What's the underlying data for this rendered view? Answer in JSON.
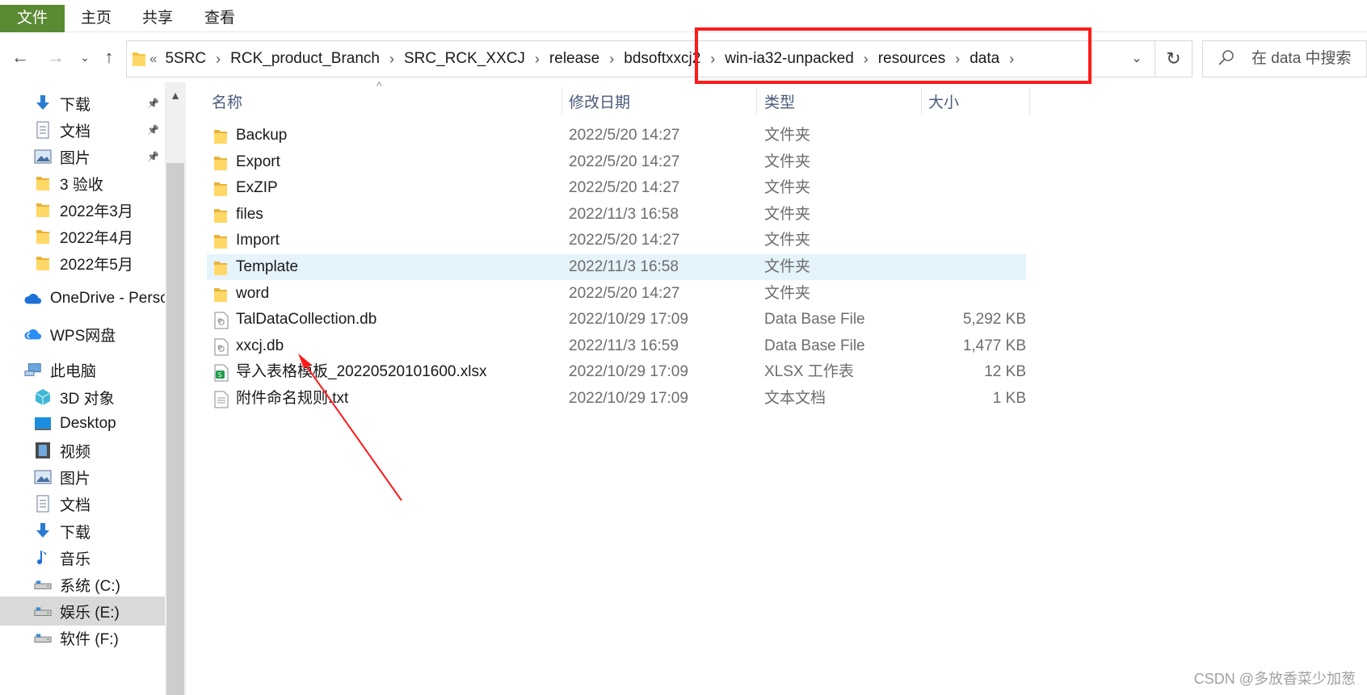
{
  "ribbon": {
    "file": "文件",
    "home": "主页",
    "share": "共享",
    "view": "查看"
  },
  "address": {
    "lead": "«",
    "crumbs": [
      "5SRC",
      "RCK_product_Branch",
      "SRC_RCK_XXCJ",
      "release",
      "bdsoftxxcj2",
      "win-ia32-unpacked",
      "resources",
      "data"
    ]
  },
  "search": {
    "placeholder": "在 data 中搜索"
  },
  "sidebar": {
    "items": [
      {
        "label": "下载",
        "icon": "download-arrow-icon",
        "pinned": true
      },
      {
        "label": "文档",
        "icon": "document-icon",
        "pinned": true
      },
      {
        "label": "图片",
        "icon": "picture-icon",
        "pinned": true
      },
      {
        "label": "3 验收",
        "icon": "folder-icon"
      },
      {
        "label": "2022年3月",
        "icon": "folder-icon"
      },
      {
        "label": "2022年4月",
        "icon": "folder-icon"
      },
      {
        "label": "2022年5月",
        "icon": "folder-icon"
      },
      {
        "label": "OneDrive - Perso",
        "icon": "cloud-icon"
      },
      {
        "label": "WPS网盘",
        "icon": "wps-cloud-icon"
      },
      {
        "label": "此电脑",
        "icon": "computer-icon"
      },
      {
        "label": "3D 对象",
        "icon": "cube-icon"
      },
      {
        "label": "Desktop",
        "icon": "desktop-icon"
      },
      {
        "label": "视频",
        "icon": "video-icon"
      },
      {
        "label": "图片",
        "icon": "picture-icon"
      },
      {
        "label": "文档",
        "icon": "document-icon"
      },
      {
        "label": "下载",
        "icon": "download-arrow-icon"
      },
      {
        "label": "音乐",
        "icon": "music-icon"
      },
      {
        "label": "系统 (C:)",
        "icon": "drive-icon"
      },
      {
        "label": "娱乐 (E:)",
        "icon": "drive-icon",
        "selected": true
      },
      {
        "label": "软件 (F:)",
        "icon": "drive-icon"
      }
    ]
  },
  "columns": {
    "name": "名称",
    "date": "修改日期",
    "type": "类型",
    "size": "大小"
  },
  "files": [
    {
      "name": "Backup",
      "date": "2022/5/20 14:27",
      "type": "文件夹",
      "size": "",
      "icon": "folder-icon"
    },
    {
      "name": "Export",
      "date": "2022/5/20 14:27",
      "type": "文件夹",
      "size": "",
      "icon": "folder-icon"
    },
    {
      "name": "ExZIP",
      "date": "2022/5/20 14:27",
      "type": "文件夹",
      "size": "",
      "icon": "folder-icon"
    },
    {
      "name": "files",
      "date": "2022/11/3 16:58",
      "type": "文件夹",
      "size": "",
      "icon": "folder-icon"
    },
    {
      "name": "Import",
      "date": "2022/5/20 14:27",
      "type": "文件夹",
      "size": "",
      "icon": "folder-icon"
    },
    {
      "name": "Template",
      "date": "2022/11/3 16:58",
      "type": "文件夹",
      "size": "",
      "icon": "folder-icon",
      "hover": true
    },
    {
      "name": "word",
      "date": "2022/5/20 14:27",
      "type": "文件夹",
      "size": "",
      "icon": "folder-icon"
    },
    {
      "name": "TalDataCollection.db",
      "date": "2022/10/29 17:09",
      "type": "Data Base File",
      "size": "5,292 KB",
      "icon": "db-file-icon"
    },
    {
      "name": "xxcj.db",
      "date": "2022/11/3 16:59",
      "type": "Data Base File",
      "size": "1,477 KB",
      "icon": "db-file-icon"
    },
    {
      "name": "导入表格模板_20220520101600.xlsx",
      "date": "2022/10/29 17:09",
      "type": "XLSX 工作表",
      "size": "12 KB",
      "icon": "xlsx-file-icon"
    },
    {
      "name": "附件命名规则.txt",
      "date": "2022/10/29 17:09",
      "type": "文本文档",
      "size": "1 KB",
      "icon": "txt-file-icon"
    }
  ],
  "watermark": "CSDN @多放香菜少加葱",
  "colors": {
    "file_tab": "#5a8a32",
    "highlight_box": "#ff1a1a",
    "arrow": "#ff1a1a",
    "hover_row": "#e5f3fb"
  }
}
